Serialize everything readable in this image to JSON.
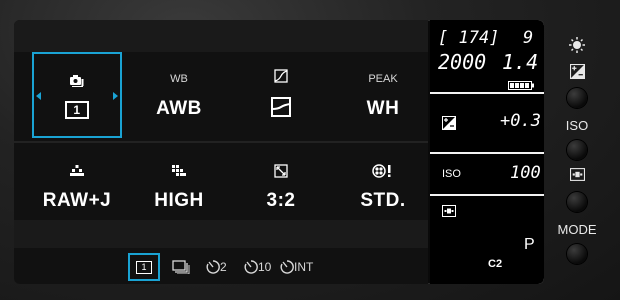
{
  "settings": {
    "row1": [
      {
        "caption": "",
        "caption_icon": "camera-stack-icon",
        "value": "1",
        "value_icon": "single-frame-icon",
        "selected": true
      },
      {
        "caption": "WB",
        "value": "AWB"
      },
      {
        "caption": "",
        "caption_icon": "tone-curve-icon",
        "value": "",
        "value_icon": "tone-curve-icon"
      },
      {
        "caption": "PEAK",
        "value": "WH"
      }
    ],
    "row2": [
      {
        "caption": "",
        "caption_icon": "image-quality-icon",
        "value": "RAW+J"
      },
      {
        "caption": "",
        "caption_icon": "image-size-icon",
        "value": "HIGH"
      },
      {
        "caption": "",
        "caption_icon": "aspect-ratio-icon",
        "value": "3:2"
      },
      {
        "caption": "",
        "caption_icon": "color-mode-icon",
        "value": "STD."
      }
    ]
  },
  "drive_modes": [
    {
      "label": "1",
      "icon": "single-frame-icon",
      "selected": true
    },
    {
      "label": "",
      "icon": "continuous-icon"
    },
    {
      "label": "2",
      "icon": "self-timer-icon"
    },
    {
      "label": "10",
      "icon": "self-timer-icon"
    },
    {
      "label": "INT",
      "icon": "interval-timer-icon"
    }
  ],
  "status": {
    "shots_remaining": "[ 174]",
    "af_mode_digit": "9",
    "shutter_speed": "2000",
    "aperture": "1.4",
    "battery_icon": "battery-icon",
    "exposure_comp_icon": "exposure-comp-icon",
    "exposure_comp": "+0.3",
    "iso_label": "ISO",
    "iso": "100",
    "metering_icon": "metering-icon",
    "mode": "P",
    "custom_mode": "C2"
  },
  "side_controls": {
    "brightness_icon": "brightness-icon",
    "exposure_icon": "exposure-comp-icon",
    "iso_label": "ISO",
    "metering_icon": "metering-icon",
    "mode_label": "MODE"
  },
  "colors": {
    "accent": "#1aa3d4",
    "screen": "#0a0a0a",
    "status_bg": "#000000"
  }
}
